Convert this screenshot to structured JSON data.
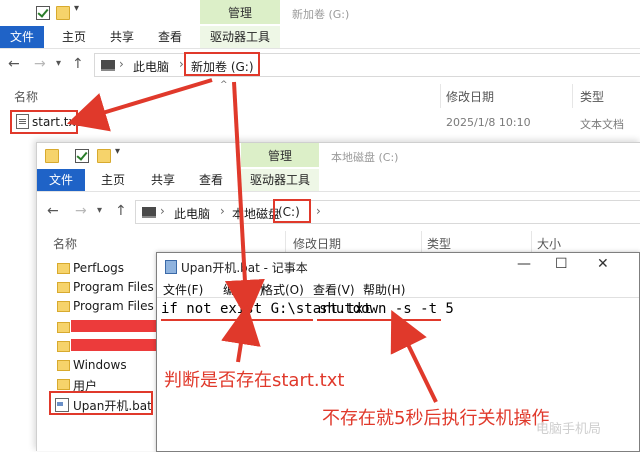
{
  "top_window": {
    "manage_tab": "管理",
    "window_title": "新加卷 (G:)",
    "tabs": [
      "文件",
      "主页",
      "共享",
      "查看",
      "驱动器工具"
    ],
    "address": {
      "root": "此电脑",
      "current": "新加卷 (G:)"
    },
    "columns": {
      "name": "名称",
      "modified": "修改日期",
      "type": "类型"
    },
    "file": {
      "name": "start.txt",
      "modified": "2025/1/8 10:10",
      "type": "文本文档"
    }
  },
  "second_window": {
    "manage_tab": "管理",
    "window_title": "本地磁盘 (C:)",
    "tabs": [
      "文件",
      "主页",
      "共享",
      "查看",
      "驱动器工具"
    ],
    "address": {
      "root": "此电脑",
      "current_prefix": "本地磁盘",
      "current_drive": "(C:)"
    },
    "columns": {
      "name": "名称",
      "modified": "修改日期",
      "type": "类型",
      "size": "大小"
    },
    "items": [
      "PerfLogs",
      "Program Files",
      "Program Files (",
      "Windows",
      "用户",
      "Upan开机.bat"
    ]
  },
  "notepad": {
    "title": "Upan开机.bat - 记事本",
    "menu": [
      "文件(F)",
      "编辑(E)",
      "格式(O)",
      "查看(V)",
      "帮助(H)"
    ],
    "code_part1": "if not exist G:\\start.txt",
    "code_part2": "shutdown -s -t 5"
  },
  "annotations": {
    "left": "判断是否存在start.txt",
    "right": "不存在就5秒后执行关机操作",
    "color": "#e0392b"
  },
  "watermark": "电脑手机局"
}
